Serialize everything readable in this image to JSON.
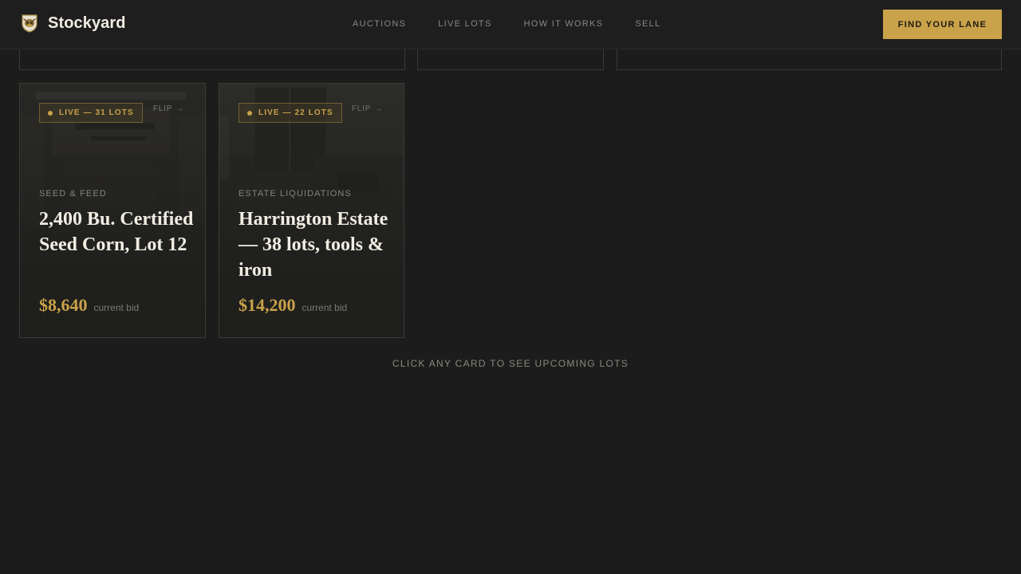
{
  "header": {
    "brand_name": "Stockyard",
    "nav": [
      "AUCTIONS",
      "LIVE LOTS",
      "HOW IT WORKS",
      "SELL"
    ],
    "cta_label": "FIND YOUR LANE"
  },
  "cards": [
    {
      "badge": "LIVE — 31 LOTS",
      "flip_label": "FLIP",
      "flip_arrow": "→",
      "category": "SEED & FEED",
      "title": "2,400 Bu. Certified Seed Corn, Lot 12",
      "price": "$8,640",
      "price_label": "current bid"
    },
    {
      "badge": "LIVE — 22 LOTS",
      "flip_label": "FLIP",
      "flip_arrow": "→",
      "category": "ESTATE LIQUIDATIONS",
      "title": "Harrington Estate — 38 lots, tools & iron",
      "price": "$14,200",
      "price_label": "current bid"
    }
  ],
  "hint": "CLICK ANY CARD TO SEE UPCOMING LOTS",
  "colors": {
    "background": "#1c1c1c",
    "accent": "#c9a24a",
    "text": "#f1ede3",
    "muted": "#8a877f"
  },
  "icons": {
    "brand": "cow-head-shield-icon",
    "live": "live-dot-icon",
    "flip": "arrow-right-icon"
  }
}
